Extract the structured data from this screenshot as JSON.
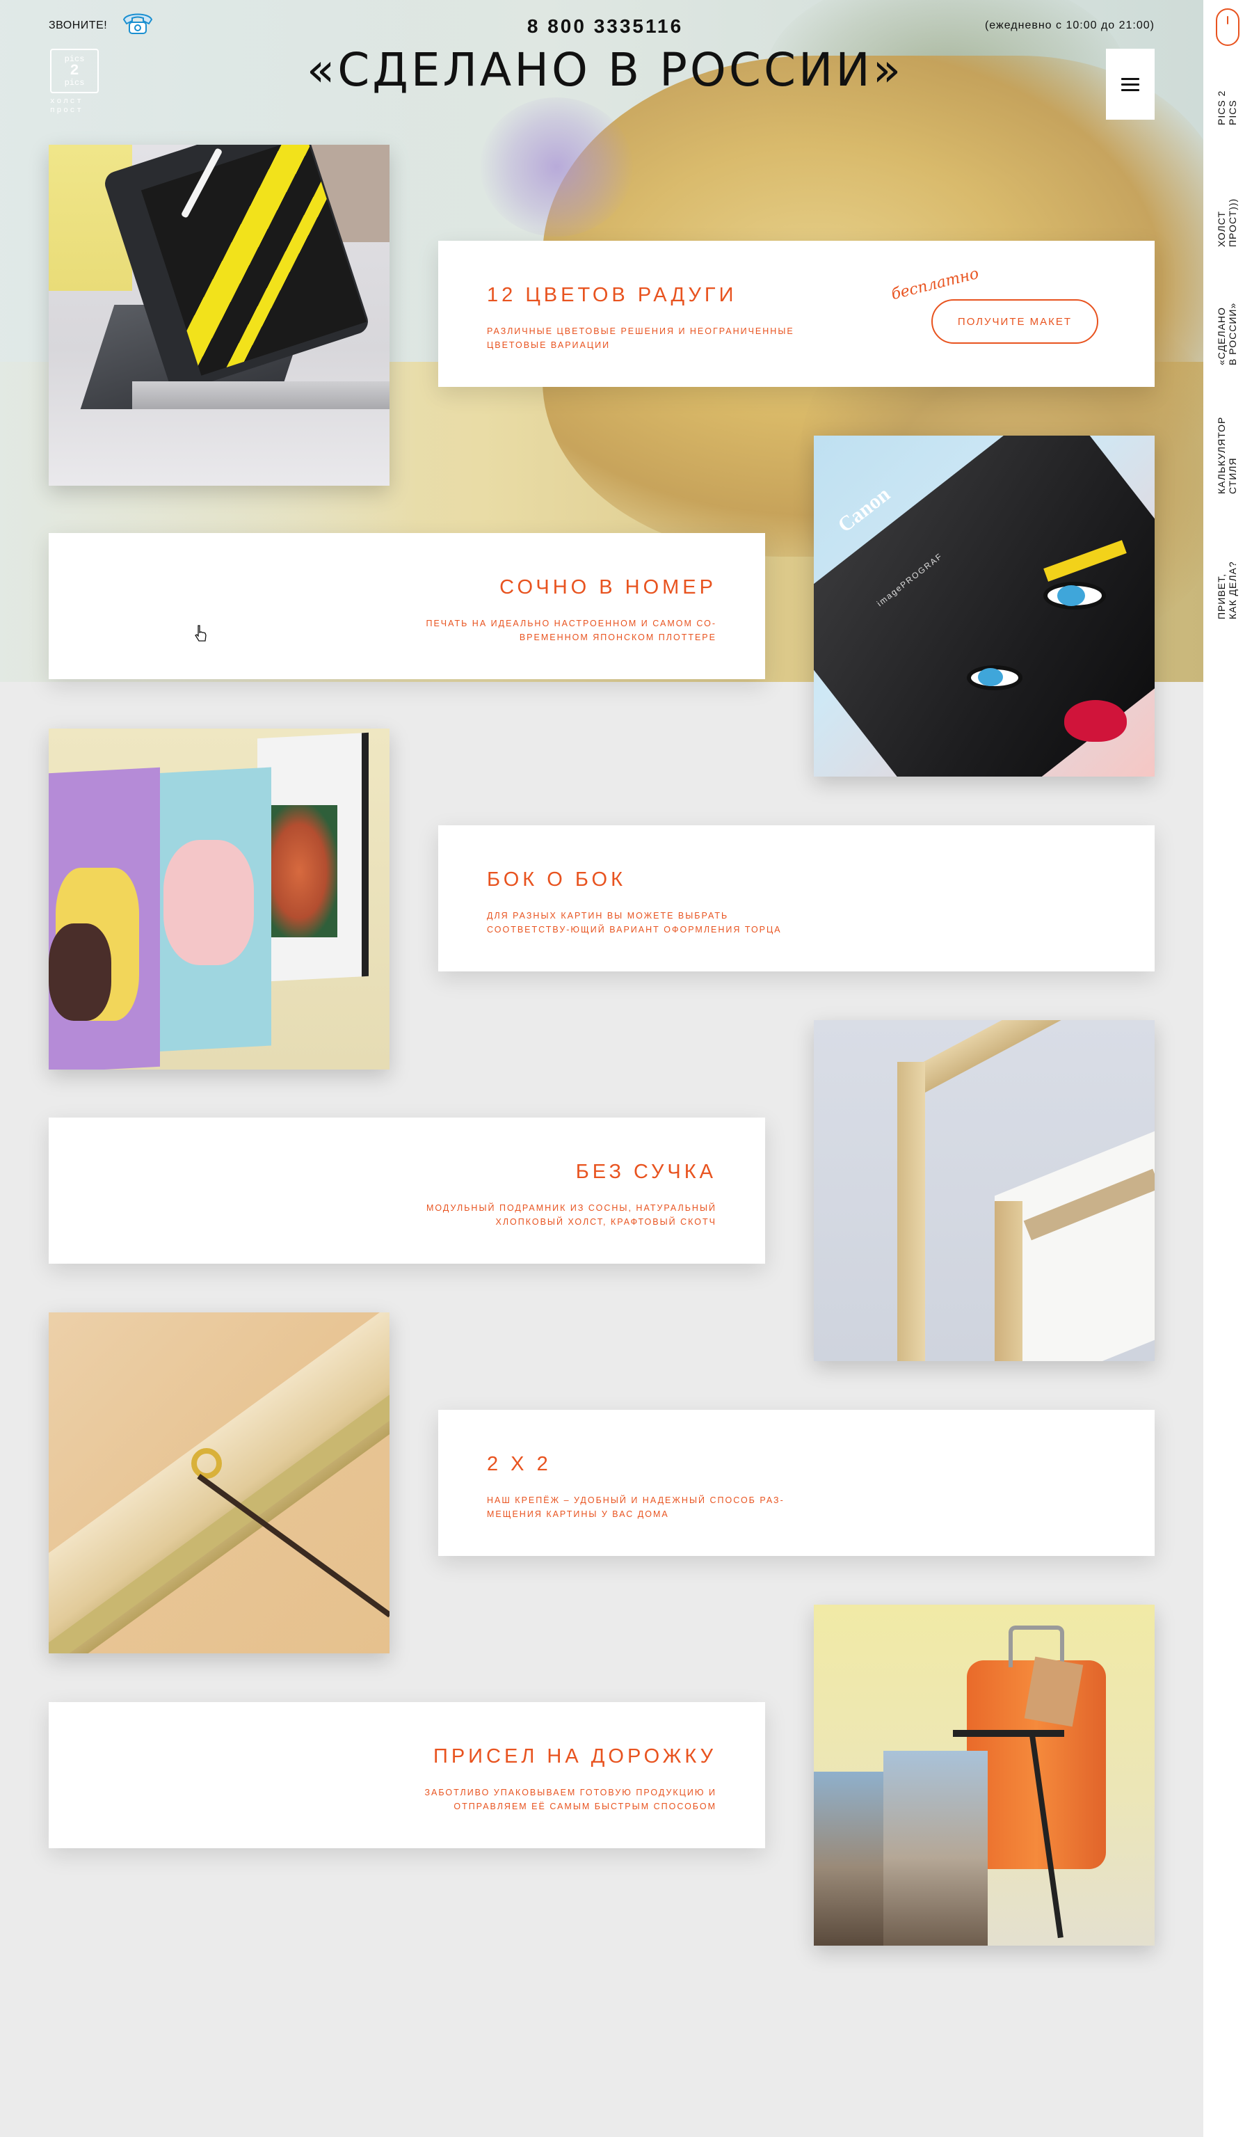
{
  "header": {
    "call_label": "ЗВОНИТЕ!",
    "phone": "8 800 3335116",
    "hours": "(ежедневно с 10:00 до 21:00)",
    "title": "«СДЕЛАНО В РОССИИ»",
    "logo_top": "pics",
    "logo_mid": "2",
    "logo_bottom": "pics",
    "logo_sub_1": "холст",
    "logo_sub_2": "прост"
  },
  "sidebar": {
    "items": [
      {
        "label": "pics 2\npics"
      },
      {
        "label": "холст\nпрост)))"
      },
      {
        "label": "«сделано\nв россии»"
      },
      {
        "label": "калькулятор\nстиля"
      },
      {
        "label": "привет,\nкак дела?"
      }
    ]
  },
  "cards": [
    {
      "title": "12 цветов радуги",
      "desc": "различные цветовые решения и неограниченные цветовые вариации",
      "free_label": "бесплатно",
      "cta": "получите макет"
    },
    {
      "title": "сочно в номер",
      "desc": "печать на идеально настроенном и самом со-временном японском плоттере"
    },
    {
      "title": "бок о бок",
      "desc": "для разных картин вы можете выбрать соответству-ющий вариант оформления торца"
    },
    {
      "title": "без сучка",
      "desc": "модульный подрамник из сосны, натуральный хлопковый холст, крафтовый скотч"
    },
    {
      "title": "2 x 2",
      "desc": "наш крепёж – удобный и надежный способ раз-мещения картины у вас дома"
    },
    {
      "title": "присел на дорожку",
      "desc": "заботливо упаковываем готовую продукцию и отправляем её самым быстрым способом"
    }
  ],
  "photos": {
    "canon_brand": "Canon",
    "plotter_label": "imagePROGRAF"
  },
  "colors": {
    "accent": "#e8531f",
    "background": "#ebebeb"
  }
}
